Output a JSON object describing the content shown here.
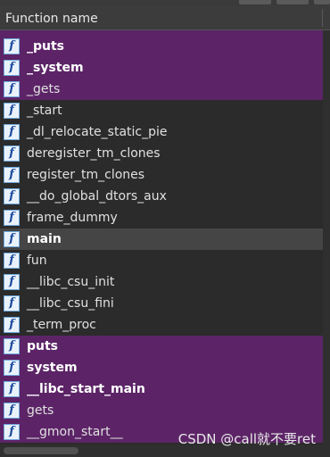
{
  "header": {
    "column_title": "Function name"
  },
  "colors": {
    "library_row": "#5c2467",
    "selected_row": "#454545",
    "background": "#2b2b2b"
  },
  "icon": {
    "glyph": "f",
    "name": "function-icon"
  },
  "rows": [
    {
      "name": "_puts",
      "style": "lib",
      "bold": true
    },
    {
      "name": "_system",
      "style": "lib",
      "bold": true
    },
    {
      "name": "_gets",
      "style": "lib",
      "bold": false
    },
    {
      "name": "_start",
      "style": "normal",
      "bold": false
    },
    {
      "name": "_dl_relocate_static_pie",
      "style": "normal",
      "bold": false
    },
    {
      "name": "deregister_tm_clones",
      "style": "normal",
      "bold": false
    },
    {
      "name": "register_tm_clones",
      "style": "normal",
      "bold": false
    },
    {
      "name": "__do_global_dtors_aux",
      "style": "normal",
      "bold": false
    },
    {
      "name": "frame_dummy",
      "style": "normal",
      "bold": false
    },
    {
      "name": "main",
      "style": "selected",
      "bold": true
    },
    {
      "name": "fun",
      "style": "normal",
      "bold": false
    },
    {
      "name": "__libc_csu_init",
      "style": "normal",
      "bold": false
    },
    {
      "name": "__libc_csu_fini",
      "style": "normal",
      "bold": false
    },
    {
      "name": "_term_proc",
      "style": "normal",
      "bold": false
    },
    {
      "name": "puts",
      "style": "lib",
      "bold": true
    },
    {
      "name": "system",
      "style": "lib",
      "bold": true
    },
    {
      "name": "__libc_start_main",
      "style": "lib",
      "bold": true
    },
    {
      "name": "gets",
      "style": "lib",
      "bold": false
    },
    {
      "name": "__gmon_start__",
      "style": "lib",
      "bold": false
    }
  ],
  "watermark": "CSDN @call就不要ret"
}
